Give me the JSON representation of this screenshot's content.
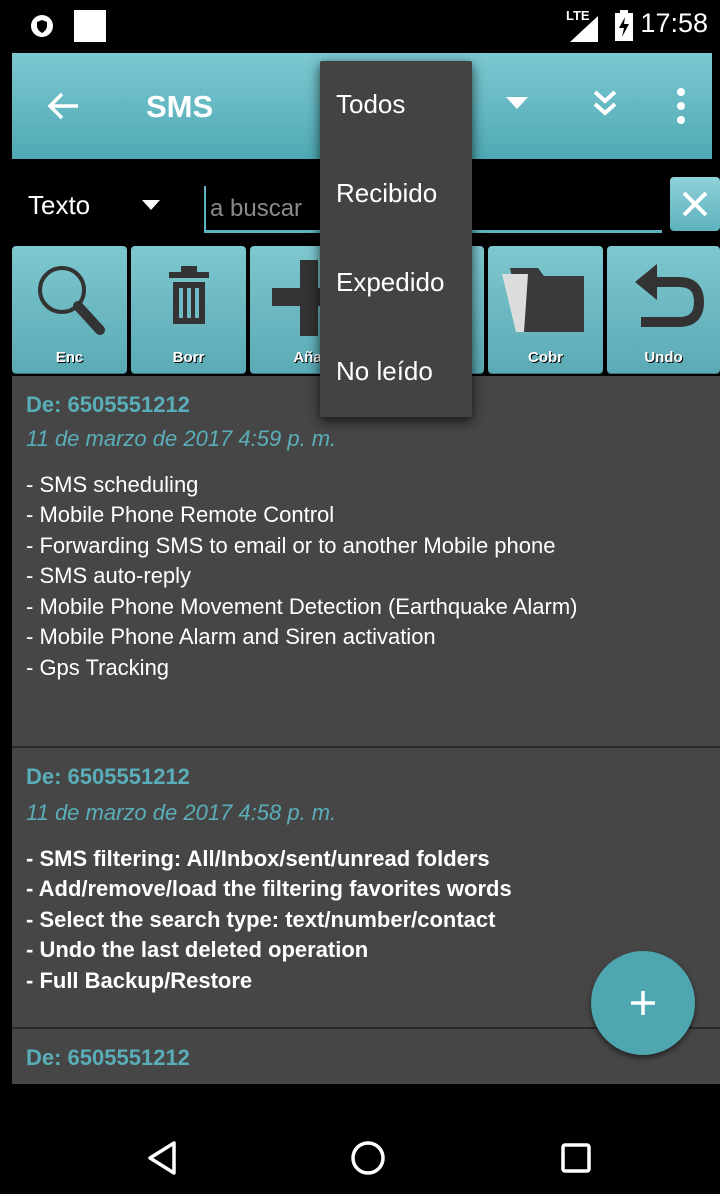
{
  "status_bar": {
    "time": "17:58",
    "network": "LTE",
    "icons": [
      "vpn-key-icon",
      "notification-square-icon",
      "signal-icon",
      "battery-charging-icon"
    ]
  },
  "app_bar": {
    "title": "SMS",
    "icons": [
      "back-arrow-icon",
      "dropdown-caret-icon",
      "double-chevron-icon",
      "overflow-menu-icon"
    ]
  },
  "search": {
    "type_label": "Texto",
    "placeholder": "a buscar",
    "clear_icon": "close-icon"
  },
  "toolbar": [
    {
      "label": "Enc",
      "icon": "search-icon"
    },
    {
      "label": "Borr",
      "icon": "trash-icon"
    },
    {
      "label": "Aña",
      "icon": "plus-icon"
    },
    {
      "label": "Cobr",
      "icon": "folder-icon"
    },
    {
      "label": "Undo",
      "icon": "undo-icon"
    }
  ],
  "dropdown_menu": {
    "items": [
      "Todos",
      "Recibido",
      "Expedido",
      "No leído"
    ]
  },
  "messages": [
    {
      "from": "De:  6505551212",
      "date": "11 de marzo de 2017 4:59 p. m.",
      "lines": [
        "- SMS scheduling",
        "- Mobile Phone Remote Control",
        "- Forwarding SMS to email or to another Mobile phone",
        "- SMS auto-reply",
        "- Mobile Phone Movement Detection (Earthquake Alarm)",
        "- Mobile Phone Alarm and Siren activation",
        "- Gps Tracking"
      ]
    },
    {
      "from": "De:  6505551212",
      "date": "11 de marzo de 2017 4:58 p. m.",
      "lines": [
        "- SMS filtering: All/Inbox/sent/unread folders",
        "- Add/remove/load the filtering favorites words",
        "- Select the search type: text/number/contact",
        "- Undo the last deleted operation",
        "- Full Backup/Restore"
      ]
    },
    {
      "from": "De:  6505551212"
    }
  ],
  "fab": {
    "icon": "add-icon"
  },
  "nav_bar": {
    "icons": [
      "back-triangle-icon",
      "home-circle-icon",
      "recents-square-icon"
    ]
  },
  "colors": {
    "accent": "#5aaeb9",
    "app_bar": "#63b5bf",
    "list_bg": "#464646",
    "menu_bg": "#434343"
  }
}
